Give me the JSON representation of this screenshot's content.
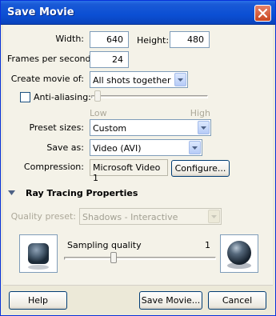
{
  "window": {
    "title": "Save Movie"
  },
  "width": {
    "label": "Width:",
    "value": "640"
  },
  "height": {
    "label": "Height:",
    "value": "480"
  },
  "fps": {
    "label": "Frames per second:",
    "value": "24"
  },
  "create_movie": {
    "label": "Create movie of:",
    "value": "All shots together"
  },
  "antialiasing": {
    "label": "Anti-aliasing:",
    "checked": false,
    "low_label": "Low",
    "high_label": "High"
  },
  "preset_sizes": {
    "label": "Preset sizes:",
    "value": "Custom"
  },
  "save_as": {
    "label": "Save as:",
    "value": "Video (AVI)"
  },
  "compression": {
    "label": "Compression:",
    "value": "Microsoft Video 1",
    "configure_label": "Configure..."
  },
  "ray_tracing": {
    "heading": "Ray Tracing Properties",
    "quality_preset_label": "Quality preset:",
    "quality_preset_value": "Shadows - Interactive",
    "sampling_label": "Sampling quality",
    "sampling_value": "1"
  },
  "buttons": {
    "help": "Help",
    "save": "Save Movie...",
    "cancel": "Cancel"
  },
  "colors": {
    "titlebar": "#0b4fd4",
    "close": "#c9461f",
    "panel": "#ece9d8"
  }
}
